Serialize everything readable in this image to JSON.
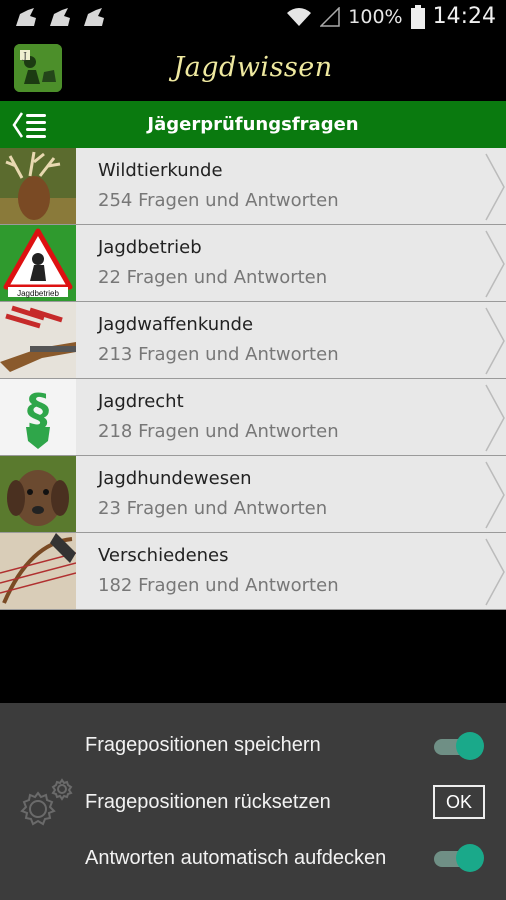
{
  "status": {
    "battery": "100%",
    "time": "14:24"
  },
  "app": {
    "title": "Jagdwissen"
  },
  "subheader": {
    "title": "Jägerprüfungsfragen"
  },
  "categories": [
    {
      "title": "Wildtierkunde",
      "subtitle": "254 Fragen und Antworten",
      "icon": "deer-photo"
    },
    {
      "title": "Jagdbetrieb",
      "subtitle": "22 Fragen und Antworten",
      "icon": "hunter-warning-sign",
      "sign_text": "Jagdbetrieb"
    },
    {
      "title": "Jagdwaffenkunde",
      "subtitle": "213 Fragen und Antworten",
      "icon": "rifle-cartridges-photo"
    },
    {
      "title": "Jagdrecht",
      "subtitle": "218 Fragen und Antworten",
      "icon": "paragraph-shield-icon"
    },
    {
      "title": "Jagdhundewesen",
      "subtitle": "23 Fragen und Antworten",
      "icon": "hunting-dog-photo"
    },
    {
      "title": "Verschiedenes",
      "subtitle": "182 Fragen und Antworten",
      "icon": "bow-arrows-photo"
    }
  ],
  "settings": {
    "save_positions": {
      "label": "Fragepositionen speichern",
      "on": true
    },
    "reset_positions": {
      "label": "Fragepositionen rücksetzen",
      "button": "OK"
    },
    "auto_reveal": {
      "label": "Antworten automatisch aufdecken",
      "on": true
    }
  }
}
